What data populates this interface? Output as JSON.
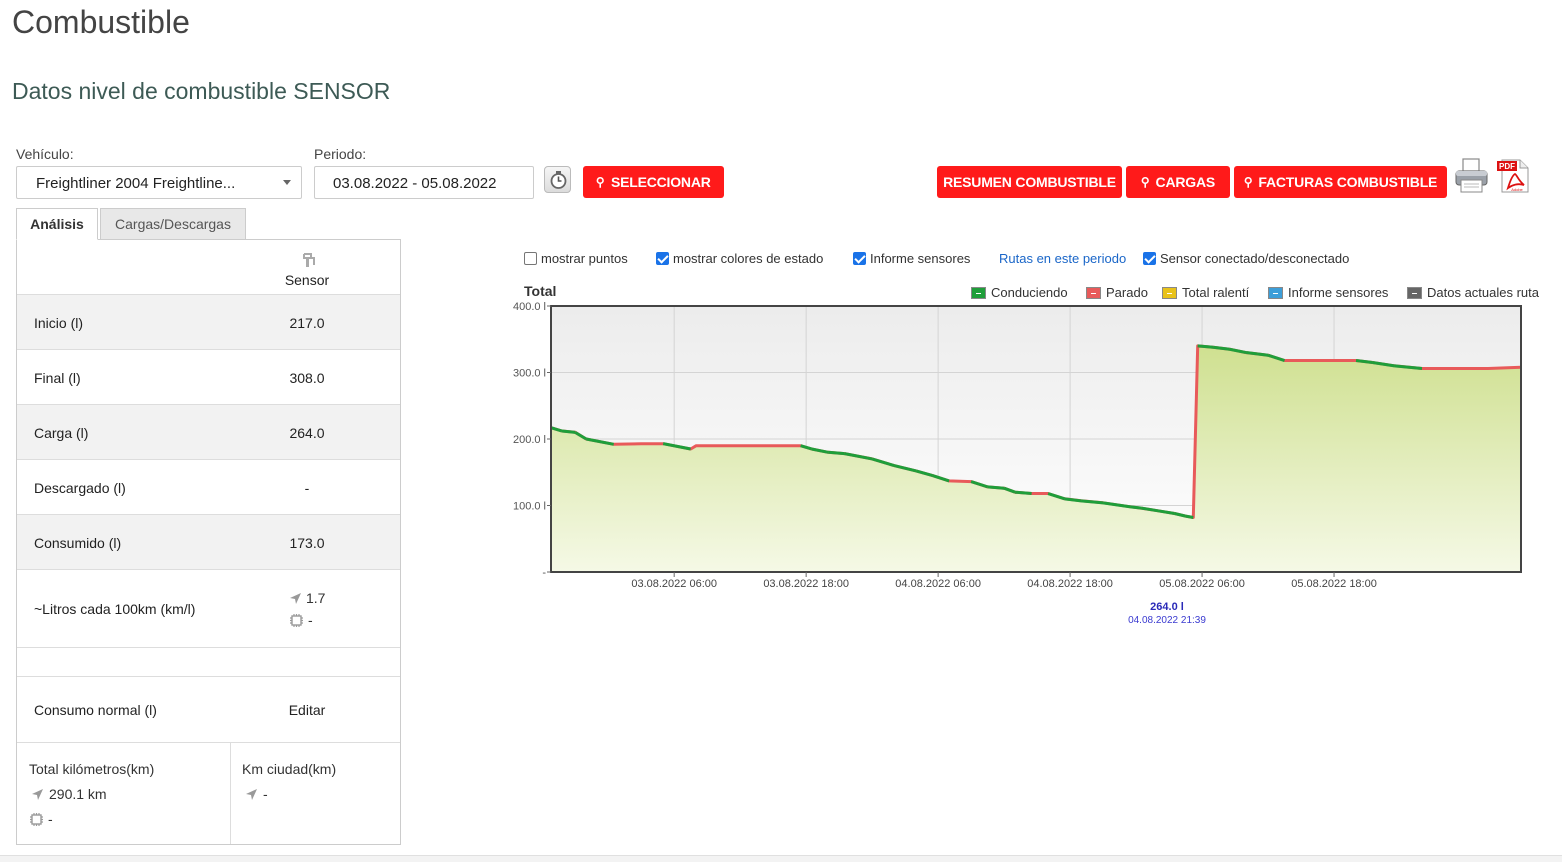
{
  "page": {
    "title": "Combustible",
    "subtitle": "Datos nivel de combustible SENSOR"
  },
  "filters": {
    "vehicle_label": "Vehículo:",
    "vehicle_value": "Freightliner 2004 Freightline...",
    "period_label": "Periodo:",
    "period_value": "03.08.2022 - 05.08.2022"
  },
  "buttons": {
    "select": "SELECCIONAR",
    "summary": "RESUMEN COMBUSTIBLE",
    "loads": "CARGAS",
    "invoices": "FACTURAS COMBUSTIBLE"
  },
  "icons": {
    "print": "printer-icon",
    "pdf": "pdf-icon",
    "pdf_text": "PDF",
    "pdf_brand": "Adobe"
  },
  "tabs": [
    {
      "label": "Análisis"
    },
    {
      "label": "Cargas/Descargas"
    }
  ],
  "analysis": {
    "column_header": "Sensor",
    "rows": [
      {
        "label": "Inicio (l)",
        "value": "217.0"
      },
      {
        "label": "Final (l)",
        "value": "308.0"
      },
      {
        "label": "Carga (l)",
        "value": "264.0"
      },
      {
        "label": "Descargado (l)",
        "value": "-"
      },
      {
        "label": "Consumido (l)",
        "value": "173.0"
      }
    ],
    "per100_label": "~Litros cada 100km (km/l)",
    "per100_gps": "1.7",
    "per100_sensor": "-",
    "normal_label": "Consumo normal (l)",
    "normal_edit": "Editar",
    "total_km_label": "Total kilómetros(km)",
    "total_km_gps": "290.1 km",
    "total_km_sensor": "-",
    "city_km_label": "Km ciudad(km)",
    "city_km_gps": "-"
  },
  "options": {
    "show_points": "mostrar puntos",
    "show_status_colors": "mostrar colores de estado",
    "sensor_report": "Informe sensores",
    "routes_link": "Rutas en este periodo",
    "sensor_connected": "Sensor conectado/desconectado"
  },
  "legend": {
    "title": "Total",
    "items": [
      {
        "label": "Conduciendo",
        "color": "#1f9e3a"
      },
      {
        "label": "Parado",
        "color": "#e85a5a"
      },
      {
        "label": "Total ralentí",
        "color": "#e8c21a"
      },
      {
        "label": "Informe sensores",
        "color": "#3d9ed8"
      },
      {
        "label": "Datos actuales ruta",
        "color": "#666666"
      }
    ]
  },
  "tooltip": {
    "value": "264.0 l",
    "date": "04.08.2022 21:39"
  },
  "chart_data": {
    "type": "area",
    "title": "Total",
    "ylim": [
      0,
      400
    ],
    "y_ticks": [
      {
        "v": 0,
        "label": "-"
      },
      {
        "v": 100,
        "label": "100.0 l"
      },
      {
        "v": 200,
        "label": "200.0 l"
      },
      {
        "v": 300,
        "label": "300.0 l"
      },
      {
        "v": 400,
        "label": "400.0 l"
      }
    ],
    "x_range_hours": [
      -5.2,
      42.8
    ],
    "x_ticks": [
      {
        "label": "03.08.2022 06:00",
        "h": 6
      },
      {
        "label": "03.08.2022 18:00",
        "h": 18
      },
      {
        "label": "04.08.2022 06:00",
        "h": 30
      },
      {
        "label": "04.08.2022 18:00",
        "h": 42
      },
      {
        "label": "05.08.2022 06:00",
        "h": 54
      },
      {
        "label": "05.08.2022 18:00",
        "h": 66
      }
    ],
    "series": [
      {
        "name": "Total",
        "points": [
          [
            -5.2,
            217
          ],
          [
            -4.2,
            212
          ],
          [
            -3.0,
            210
          ],
          [
            -2.0,
            200
          ],
          [
            0.5,
            192
          ],
          [
            3.0,
            193
          ],
          [
            5.0,
            193
          ],
          [
            7.5,
            185
          ],
          [
            8.0,
            190
          ],
          [
            12.0,
            190
          ],
          [
            17.5,
            190
          ],
          [
            18.5,
            185
          ],
          [
            20.0,
            180
          ],
          [
            21.5,
            178
          ],
          [
            24.0,
            170
          ],
          [
            26.0,
            160
          ],
          [
            28.0,
            152
          ],
          [
            29.5,
            145
          ],
          [
            31.0,
            137
          ],
          [
            33.0,
            136
          ],
          [
            34.5,
            128
          ],
          [
            36.0,
            126
          ],
          [
            37.0,
            120
          ],
          [
            38.5,
            118
          ],
          [
            40.0,
            118
          ],
          [
            41.5,
            110
          ],
          [
            43.0,
            107
          ],
          [
            45.0,
            104
          ],
          [
            47.5,
            98
          ],
          [
            48.5,
            96
          ],
          [
            50.0,
            92
          ],
          [
            51.5,
            88
          ],
          [
            52.5,
            84
          ],
          [
            53.2,
            82
          ],
          [
            53.6,
            340
          ],
          [
            55.0,
            338
          ],
          [
            56.5,
            335
          ],
          [
            58.0,
            330
          ],
          [
            59.0,
            328
          ],
          [
            60.0,
            326
          ],
          [
            61.5,
            318
          ],
          [
            63.0,
            318
          ],
          [
            68.0,
            318
          ],
          [
            69.5,
            315
          ],
          [
            71.5,
            310
          ],
          [
            74.0,
            306
          ],
          [
            80.0,
            306
          ],
          [
            83.0,
            308
          ]
        ]
      }
    ]
  }
}
